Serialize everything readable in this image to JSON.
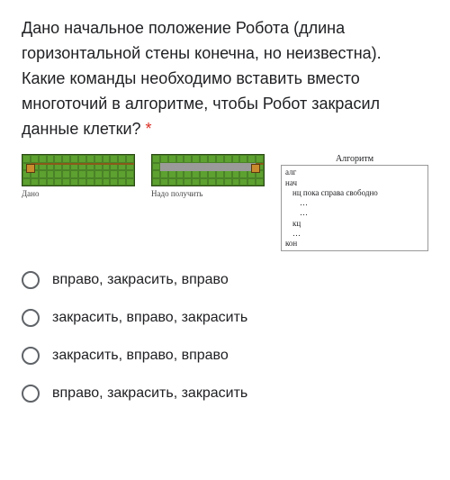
{
  "question": {
    "text": "Дано начальное положение Робота (длина горизонтальной стены конечна, но неизвестна). Какие команды необходимо вставить вместо многоточий в алгоритме, чтобы Робот закрасил данные клетки?",
    "required_mark": "*"
  },
  "figures": {
    "given_caption": "Дано",
    "result_caption": "Надо получить",
    "algo_title": "Алгоритм",
    "algo_lines": {
      "l0": "алг",
      "l1": "нач",
      "l2": "нц пока справа свободно",
      "l3": "…",
      "l4": "…",
      "l5": "кц",
      "l6": "…",
      "l7": "кон"
    }
  },
  "options": {
    "a": "вправо, закрасить, вправо",
    "b": "закрасить, вправо, закрасить",
    "c": "закрасить, вправо, вправо",
    "d": "вправо, закрасить, закрасить"
  }
}
